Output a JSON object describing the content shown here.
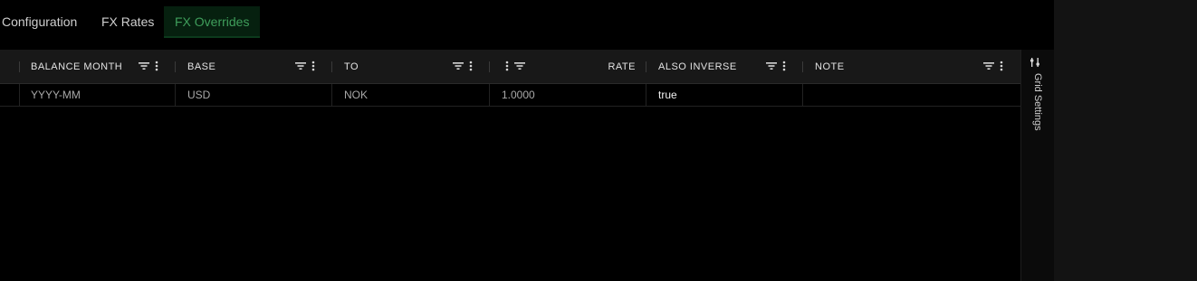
{
  "tabs": [
    {
      "label": "Configuration"
    },
    {
      "label": "FX Rates"
    },
    {
      "label": "FX Overrides"
    }
  ],
  "grid": {
    "columns": [
      {
        "label": "BALANCE MONTH"
      },
      {
        "label": "BASE"
      },
      {
        "label": "TO"
      },
      {
        "label": "RATE"
      },
      {
        "label": "ALSO INVERSE"
      },
      {
        "label": "NOTE"
      }
    ],
    "rows": [
      {
        "balance_month": "YYYY-MM",
        "base": "USD",
        "to": "NOK",
        "rate": "1.0000",
        "also_inverse": "true",
        "note": ""
      }
    ]
  },
  "side_panel": {
    "label": "Grid Settings",
    "icon": "sliders-icon"
  },
  "colors": {
    "active_tab_text": "#3f9e5b",
    "active_tab_bg": "#06200f"
  }
}
